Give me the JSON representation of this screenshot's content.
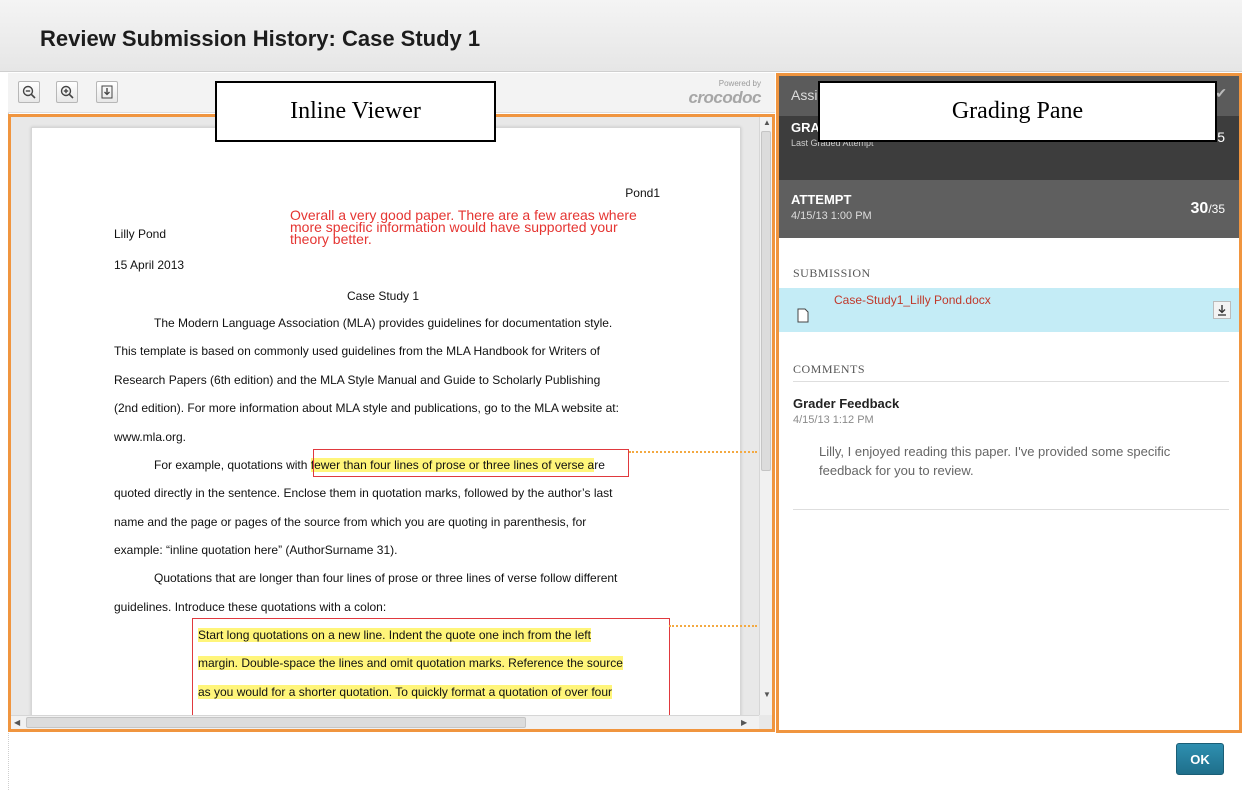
{
  "dialog": {
    "title": "Review Submission History: Case Study 1"
  },
  "toolbar": {
    "zoom_out_icon": "zoom-out-icon",
    "zoom_in_icon": "zoom-in-icon",
    "download_icon": "download-icon",
    "powered_by": "Powered by",
    "brand": "crocodoc"
  },
  "document": {
    "header_right": "Pond1",
    "author": "Lilly Pond",
    "date": "15 April 2013",
    "title": "Case Study 1",
    "annotation_comment": "Overall a very good paper. There are a few areas where more specific information would have supported your theory better.",
    "annotation_comment_lines": [
      "Overall a very good paper. There are a few areas where",
      "more specific information would have supported your",
      "theory better."
    ],
    "para1": [
      "The Modern Language Association (MLA) provides guidelines for documentation style.",
      "This template is based on commonly used guidelines from the MLA Handbook for Writers of",
      "Research Papers (6th edition) and the MLA Style Manual and Guide to Scholarly Publishing",
      "(2nd edition). For more information about MLA style and publications, go to the MLA website at:",
      "www.mla.org."
    ],
    "para2_start": "For example, quotations with ",
    "para2_highlight": "fewer than four lines of prose or three lines of verse a",
    "para2_end": "re",
    "para2_rest": [
      "quoted directly in the sentence. Enclose them in quotation marks, followed by the author’s last",
      "name and the page or pages of the source from which you are quoting in parenthesis, for",
      "example: “inline quotation here” (AuthorSurname 31)."
    ],
    "para3": [
      "Quotations that are longer than four lines of prose or three lines of verse follow different",
      "guidelines. Introduce these quotations with a colon:"
    ],
    "block_quote": [
      "Start long quotations on a new line. Indent the quote one inch from the left",
      "margin. Double-space the lines and omit quotation marks. Reference the source",
      "as you would for a shorter quotation. To quickly format a quotation of over four"
    ]
  },
  "callouts": {
    "viewer": "Inline Viewer",
    "grading": "Grading Pane"
  },
  "grading": {
    "top_label": "Assi",
    "grade_label": "GRA",
    "grade_sub": "Last Graded Attempt",
    "grade_score_fragment": "5",
    "attempt_label": "ATTEMPT",
    "attempt_date": "4/15/13 1:00 PM",
    "attempt_score": "30",
    "attempt_total": "/35",
    "submission_label": "SUBMISSION",
    "file_name": "Case-Study1_Lilly Pond.docx",
    "comments_label": "COMMENTS",
    "feedback_title": "Grader Feedback",
    "feedback_date": "4/15/13 1:12 PM",
    "feedback_text": "Lilly, I enjoyed reading this paper. I've provided some specific feedback for you to review."
  },
  "footer": {
    "ok_label": "OK"
  },
  "colors": {
    "accent_orange": "#f0953f",
    "annotation_red": "#e53532",
    "highlight": "#fff57a",
    "ok_blue": "#2581a3"
  }
}
